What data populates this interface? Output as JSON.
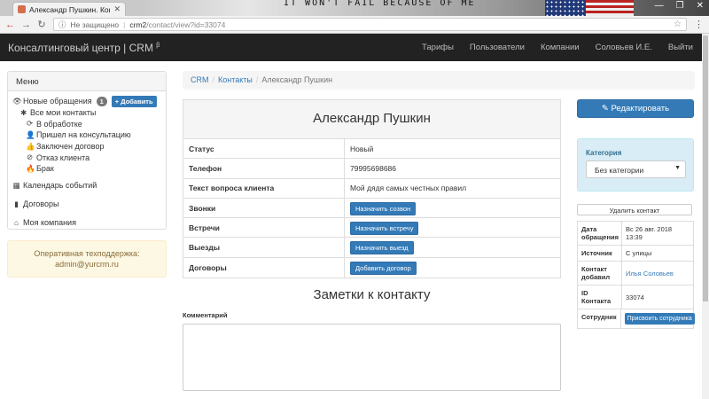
{
  "browser": {
    "tab_title": "Александр Пушкин. Кон",
    "banner_text": "IT WON'T FAIL BECAUSE OF ME",
    "security_label": "Не защищено",
    "url_host": "crm2",
    "url_path": "/contact/view?id=33074"
  },
  "navbar": {
    "brand": "Консалтинговый центр | CRM",
    "brand_sup": "β",
    "links": [
      "Тарифы",
      "Пользователи",
      "Компании",
      "Соловьев И.Е.",
      "Выйти"
    ]
  },
  "sidebar": {
    "title": "Меню",
    "new_requests": "Новые обращения",
    "new_requests_count": "1",
    "add_label": "+ Добавить",
    "all_contacts": "Все мои контакты",
    "statuses": [
      "В обработке",
      "Пришел на консультацию",
      "Заключен договор",
      "Отказ клиента",
      "Брак"
    ],
    "calendar": "Календарь событий",
    "contracts": "Договоры",
    "company": "Моя компания",
    "support_line1": "Оперативная техподдержка:",
    "support_line2": "admin@yurcrm.ru"
  },
  "breadcrumb": {
    "crm": "CRM",
    "contacts": "Контакты",
    "current": "Александр Пушкин"
  },
  "contact": {
    "name": "Александр Пушкин",
    "status_label": "Статус",
    "status_value": "Новый",
    "phone_label": "Телефон",
    "phone_value": "79995698686",
    "question_label": "Текст вопроса клиента",
    "question_value": "Мой дядя самых честных правил",
    "calls_label": "Звонки",
    "calls_button": "Назначить созвон",
    "meetings_label": "Встречи",
    "meetings_button": "Назначить встречу",
    "visits_label": "Выезды",
    "visits_button": "Назначить выезд",
    "contracts_label": "Договоры",
    "contracts_button": "Добавить договор"
  },
  "notes": {
    "title": "Заметки к контакту",
    "comment_label": "Комментарий"
  },
  "right": {
    "edit_button": "Редактировать",
    "category_label": "Категория",
    "category_value": "Без категории",
    "delete_button": "Удалить контакт",
    "date_label": "Дата обращения",
    "date_value": "Вс 26 авг. 2018 13:39",
    "source_label": "Источник",
    "source_value": "С улицы",
    "added_label": "Контакт добавил",
    "added_value": "Илья Соловьев",
    "id_label": "ID Контакта",
    "id_value": "33074",
    "employee_label": "Сотрудник",
    "assign_button": "Присвоить сотрудника"
  }
}
